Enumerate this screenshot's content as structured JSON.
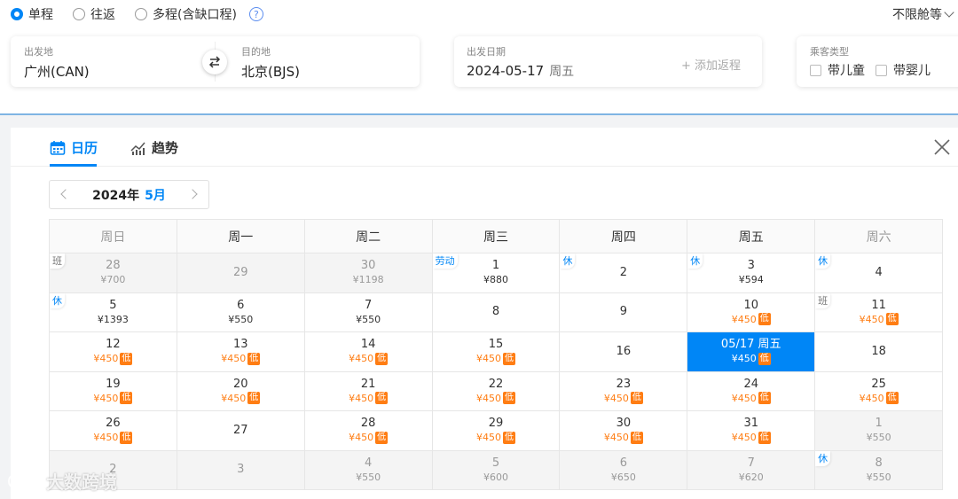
{
  "trip_types": [
    {
      "label": "单程",
      "checked": true
    },
    {
      "label": "往返",
      "checked": false
    },
    {
      "label": "多程(含缺口程)",
      "checked": false
    }
  ],
  "help_glyph": "?",
  "cabin": "不限舱等",
  "route": {
    "from_label": "出发地",
    "from_value": "广州(CAN)",
    "to_label": "目的地",
    "to_value": "北京(BJS)"
  },
  "date": {
    "label": "出发日期",
    "value": "2024-05-17",
    "weekday": "周五",
    "add_return": "+ 添加返程"
  },
  "pax": {
    "label": "乘客类型",
    "child": "带儿童",
    "infant": "带婴儿"
  },
  "tabs": {
    "calendar": "日历",
    "trend": "趋势"
  },
  "month_nav": {
    "year": "2024年",
    "month": "5月"
  },
  "weekdays": [
    "周日",
    "周一",
    "周二",
    "周三",
    "周四",
    "周五",
    "周六"
  ],
  "low_tag": "低",
  "colors": {
    "accent": "#0086f6",
    "low_price": "#ff7d13"
  },
  "weeks": [
    [
      {
        "d": "28",
        "p": "¥700",
        "other": true,
        "badge": "班"
      },
      {
        "d": "29",
        "p": "",
        "other": true
      },
      {
        "d": "30",
        "p": "¥1198",
        "other": true
      },
      {
        "d": "1",
        "p": "¥880",
        "badge": "劳动"
      },
      {
        "d": "2",
        "p": "",
        "badge": "休"
      },
      {
        "d": "3",
        "p": "¥594",
        "badge": "休"
      },
      {
        "d": "4",
        "p": "",
        "badge": "休"
      }
    ],
    [
      {
        "d": "5",
        "p": "¥1393",
        "badge": "休"
      },
      {
        "d": "6",
        "p": "¥550"
      },
      {
        "d": "7",
        "p": "¥550"
      },
      {
        "d": "8",
        "p": ""
      },
      {
        "d": "9",
        "p": ""
      },
      {
        "d": "10",
        "p": "¥450",
        "low": true
      },
      {
        "d": "11",
        "p": "¥450",
        "low": true,
        "badge": "班"
      }
    ],
    [
      {
        "d": "12",
        "p": "¥450",
        "low": true
      },
      {
        "d": "13",
        "p": "¥450",
        "low": true
      },
      {
        "d": "14",
        "p": "¥450",
        "low": true
      },
      {
        "d": "15",
        "p": "¥450",
        "low": true
      },
      {
        "d": "16",
        "p": ""
      },
      {
        "d": "05/17 周五",
        "p": "¥450",
        "low": true,
        "selected": true
      },
      {
        "d": "18",
        "p": ""
      }
    ],
    [
      {
        "d": "19",
        "p": "¥450",
        "low": true
      },
      {
        "d": "20",
        "p": "¥450",
        "low": true
      },
      {
        "d": "21",
        "p": "¥450",
        "low": true
      },
      {
        "d": "22",
        "p": "¥450",
        "low": true
      },
      {
        "d": "23",
        "p": "¥450",
        "low": true
      },
      {
        "d": "24",
        "p": "¥450",
        "low": true
      },
      {
        "d": "25",
        "p": "¥450",
        "low": true
      }
    ],
    [
      {
        "d": "26",
        "p": "¥450",
        "low": true
      },
      {
        "d": "27",
        "p": ""
      },
      {
        "d": "28",
        "p": "¥450",
        "low": true
      },
      {
        "d": "29",
        "p": "¥450",
        "low": true
      },
      {
        "d": "30",
        "p": "¥450",
        "low": true
      },
      {
        "d": "31",
        "p": "¥450",
        "low": true
      },
      {
        "d": "1",
        "p": "¥550",
        "other": true
      }
    ],
    [
      {
        "d": "2",
        "p": "",
        "other": true
      },
      {
        "d": "3",
        "p": "",
        "other": true
      },
      {
        "d": "4",
        "p": "¥550",
        "other": true
      },
      {
        "d": "5",
        "p": "¥600",
        "other": true
      },
      {
        "d": "6",
        "p": "¥650",
        "other": true
      },
      {
        "d": "7",
        "p": "¥620",
        "other": true
      },
      {
        "d": "8",
        "p": "¥550",
        "other": true,
        "badge": "休"
      }
    ]
  ],
  "watermark": "大数跨境"
}
